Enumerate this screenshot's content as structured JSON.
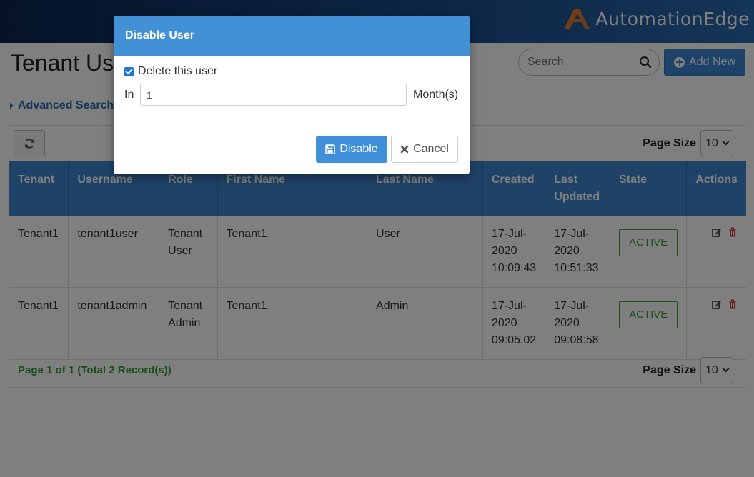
{
  "brand": {
    "name": "AutomationEdge",
    "icon": "automationedge-logo"
  },
  "page": {
    "title": "Tenant Users"
  },
  "search": {
    "placeholder": "Search",
    "icon": "search-icon"
  },
  "add_button": {
    "label": "Add New",
    "icon": "plus-circle-icon"
  },
  "advanced_search": {
    "label": "Advanced Search",
    "icon": "caret-right-icon"
  },
  "page_size": {
    "label": "Page Size",
    "value": "10"
  },
  "table": {
    "columns": [
      "Tenant",
      "Username",
      "Role",
      "First Name",
      "Last Name",
      "Created",
      "Last Updated",
      "State",
      "Actions"
    ],
    "rows": [
      {
        "tenant": "Tenant1",
        "username": "tenant1user",
        "role": "Tenant User",
        "first_name": "Tenant1",
        "last_name": "User",
        "created": "17-Jul-2020 10:09:43",
        "updated": "17-Jul-2020 10:51:33",
        "state": "ACTIVE"
      },
      {
        "tenant": "Tenant1",
        "username": "tenant1admin",
        "role": "Tenant Admin",
        "first_name": "Tenant1",
        "last_name": "Admin",
        "created": "17-Jul-2020 09:05:02",
        "updated": "17-Jul-2020 09:08:58",
        "state": "ACTIVE"
      }
    ]
  },
  "pagination": {
    "text": "Page 1 of 1 (Total 2 Record(s))"
  },
  "modal": {
    "title": "Disable User",
    "checkbox_label": "Delete this user",
    "checkbox_checked": true,
    "in_label": "In",
    "months_value": "1",
    "months_label": "Month(s)",
    "disable_label": "Disable",
    "cancel_label": "Cancel"
  },
  "colors": {
    "header_blue": "#3f86cf",
    "modal_header": "#4290d6",
    "active_green": "#3a9a3a",
    "delete_red": "#d33333"
  }
}
